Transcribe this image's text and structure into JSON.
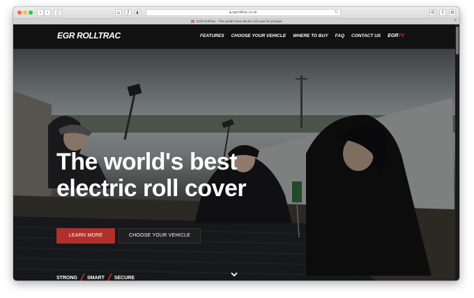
{
  "browser": {
    "url": "egrrolltrac.co.uk",
    "tab_title": "EGR RollTrac - The world's best electric roll cover for pickups",
    "flag_icon": "uk-flag-icon",
    "reload_icon": "↻",
    "add_tab_icon": "+"
  },
  "site": {
    "logo": {
      "part1": "EGR",
      "part2": "ROLLTRAC"
    },
    "nav": [
      "FEATURES",
      "CHOOSE YOUR VEHICLE",
      "WHERE TO BUY",
      "FAQ",
      "CONTACT US"
    ],
    "nav_tv": {
      "egr": "EGR",
      "tv": "TV"
    },
    "hero": {
      "headline_line1": "The world's best",
      "headline_line2": "electric roll cover",
      "learn_more": "LEARN MORE",
      "choose_vehicle": "CHOOSE YOUR VEHICLE",
      "taglines": [
        "STRONG",
        "SMART",
        "SECURE"
      ],
      "scroll_icon": "chevron-down-icon"
    }
  },
  "colors": {
    "accent": "#b1302b",
    "nav_bg": "#111111",
    "button_dark": "#1e1e1e"
  }
}
